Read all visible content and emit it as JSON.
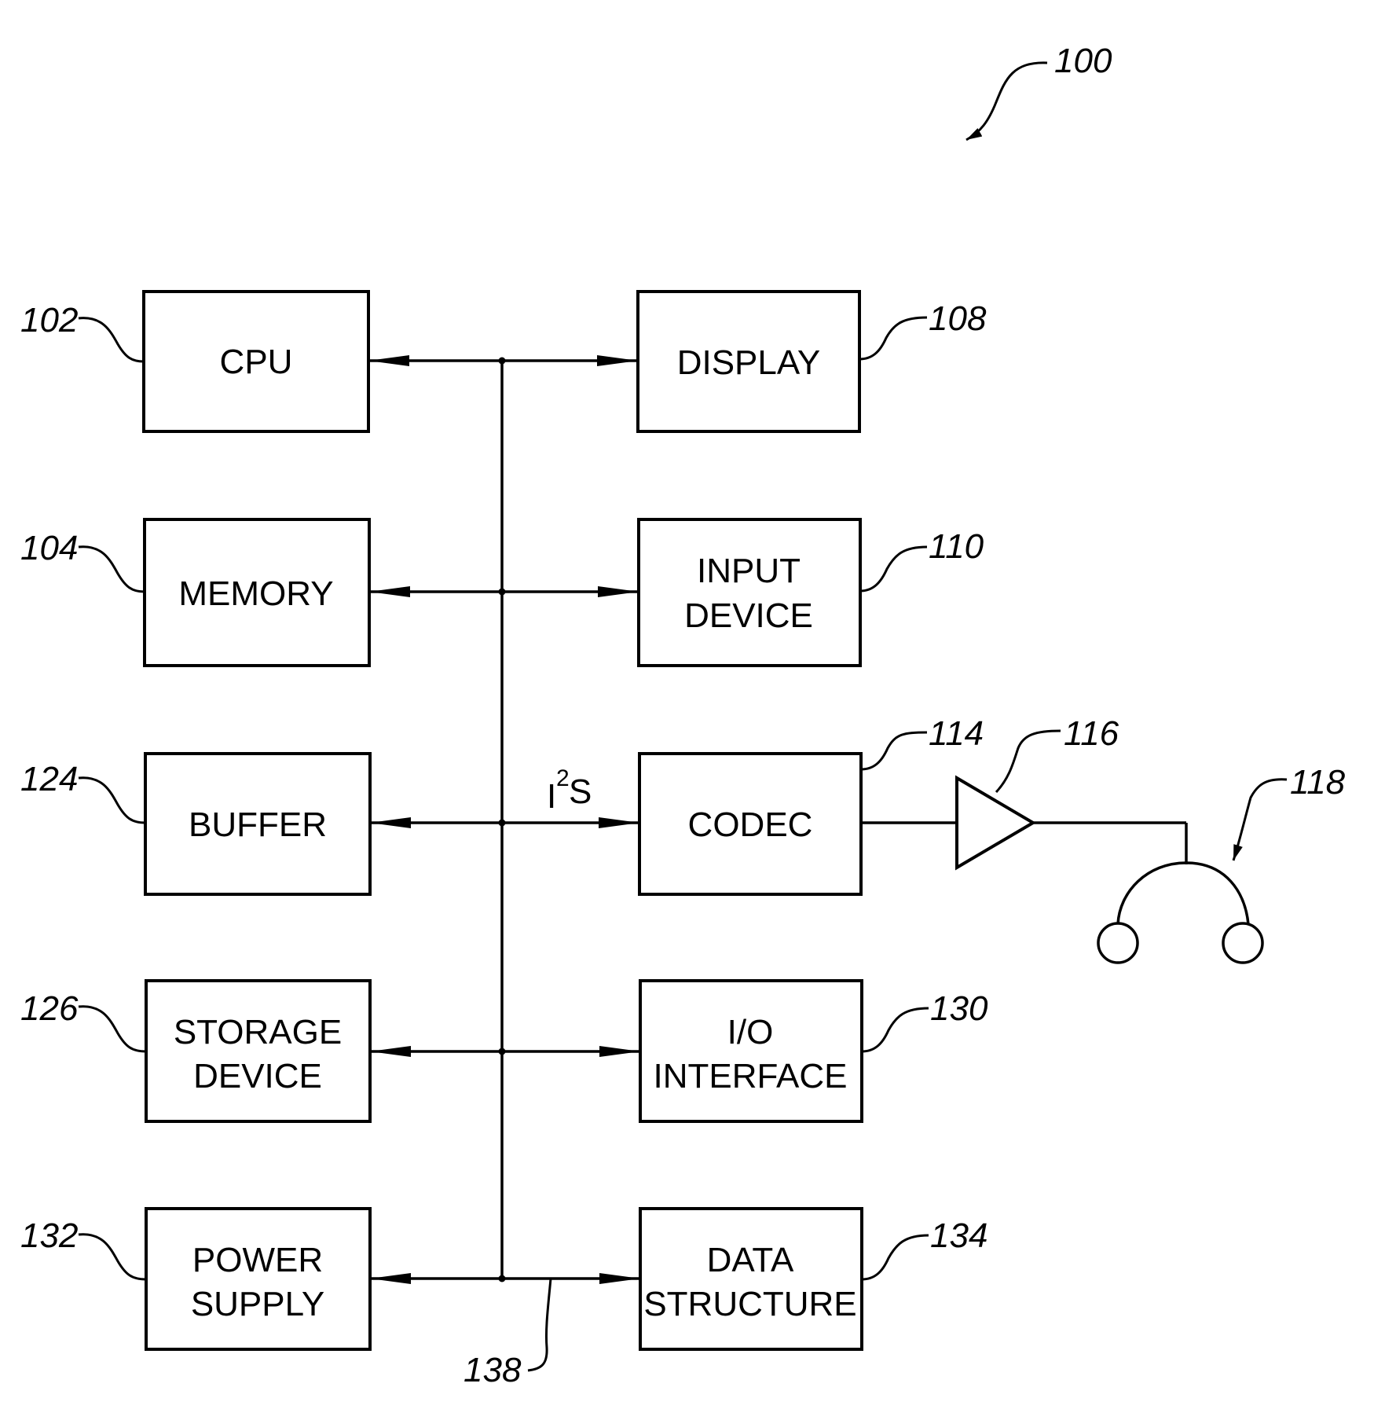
{
  "figure": {
    "reference": "100",
    "bus_reference": "138",
    "bus_protocol_label": {
      "base": "I",
      "sup": "2",
      "tail": "S"
    }
  },
  "blocks": {
    "cpu": {
      "ref": "102",
      "lines": [
        "CPU"
      ]
    },
    "memory": {
      "ref": "104",
      "lines": [
        "MEMORY"
      ]
    },
    "buffer": {
      "ref": "124",
      "lines": [
        "BUFFER"
      ]
    },
    "storage": {
      "ref": "126",
      "lines": [
        "STORAGE",
        "DEVICE"
      ]
    },
    "power": {
      "ref": "132",
      "lines": [
        "POWER",
        "SUPPLY"
      ]
    },
    "display": {
      "ref": "108",
      "lines": [
        "DISPLAY"
      ]
    },
    "input": {
      "ref": "110",
      "lines": [
        "INPUT",
        "DEVICE"
      ]
    },
    "codec": {
      "ref": "114",
      "lines": [
        "CODEC"
      ]
    },
    "io": {
      "ref": "130",
      "lines": [
        "I/O",
        "INTERFACE"
      ]
    },
    "datastructure": {
      "ref": "134",
      "lines": [
        "DATA",
        "STRUCTURE"
      ]
    }
  },
  "amplifier": {
    "ref": "116"
  },
  "headphones": {
    "ref": "118"
  }
}
